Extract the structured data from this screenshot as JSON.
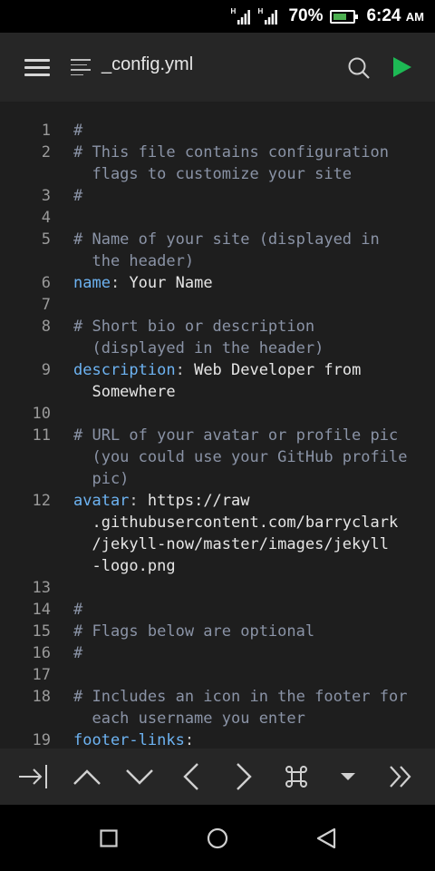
{
  "status": {
    "signal1_tag": "H",
    "signal2_tag": "H",
    "battery_percent": "70%",
    "battery_level": 0.7,
    "time": "6:24",
    "ampm": "AM"
  },
  "toolbar": {
    "file_name": "_config.yml",
    "icons": [
      "menu-icon",
      "file-icon",
      "search-icon",
      "play-icon"
    ]
  },
  "editor": {
    "lines": [
      {
        "n": "1",
        "rows": [
          [
            "#"
          ]
        ]
      },
      {
        "n": "2",
        "rows": [
          [
            "# This file contains configuration"
          ],
          [
            "  flags to customize your site"
          ]
        ]
      },
      {
        "n": "3",
        "rows": [
          [
            "#"
          ]
        ]
      },
      {
        "n": "4",
        "rows": [
          [
            ""
          ]
        ]
      },
      {
        "n": "5",
        "rows": [
          [
            "# Name of your site (displayed in"
          ],
          [
            "  the header)"
          ]
        ]
      },
      {
        "n": "6",
        "key": "name",
        "rows": [
          [
            "name",
            ":",
            " Your Name"
          ]
        ]
      },
      {
        "n": "7",
        "rows": [
          [
            ""
          ]
        ]
      },
      {
        "n": "8",
        "rows": [
          [
            "# Short bio or description"
          ],
          [
            "  (displayed in the header)"
          ]
        ]
      },
      {
        "n": "9",
        "key": "description",
        "rows": [
          [
            "description",
            ":",
            " Web Developer from"
          ],
          [
            "  Somewhere"
          ]
        ]
      },
      {
        "n": "10",
        "rows": [
          [
            ""
          ]
        ]
      },
      {
        "n": "11",
        "rows": [
          [
            "# URL of your avatar or profile pic"
          ],
          [
            "  (you could use your GitHub profile"
          ],
          [
            "  pic)"
          ]
        ]
      },
      {
        "n": "12",
        "key": "avatar",
        "rows": [
          [
            "avatar",
            ":",
            " https://raw"
          ],
          [
            "  .githubusercontent.com/barryclark"
          ],
          [
            "  /jekyll-now/master/images/jekyll"
          ],
          [
            "  -logo.png"
          ]
        ]
      },
      {
        "n": "13",
        "rows": [
          [
            ""
          ]
        ]
      },
      {
        "n": "14",
        "rows": [
          [
            "#"
          ]
        ]
      },
      {
        "n": "15",
        "rows": [
          [
            "# Flags below are optional"
          ]
        ]
      },
      {
        "n": "16",
        "rows": [
          [
            "#"
          ]
        ]
      },
      {
        "n": "17",
        "rows": [
          [
            ""
          ]
        ]
      },
      {
        "n": "18",
        "rows": [
          [
            "# Includes an icon in the footer for"
          ],
          [
            "  each username you enter"
          ]
        ]
      },
      {
        "n": "19",
        "key": "footer-links",
        "rows": [
          [
            "footer-links",
            ":",
            ""
          ]
        ]
      }
    ]
  },
  "keybar": {
    "keys": [
      "tab-icon",
      "arrow-up-icon",
      "arrow-down-icon",
      "arrow-left-icon",
      "arrow-right-icon",
      "command-icon",
      "dropdown-icon",
      "more-icon"
    ]
  },
  "navbar": {
    "buttons": [
      "recents-square-icon",
      "home-circle-icon",
      "back-triangle-icon"
    ]
  },
  "colors": {
    "comment": "#8a93a6",
    "key": "#6db3f2",
    "play": "#1db954",
    "toolbar_bg": "#262626",
    "editor_bg": "#1e1e1e"
  }
}
